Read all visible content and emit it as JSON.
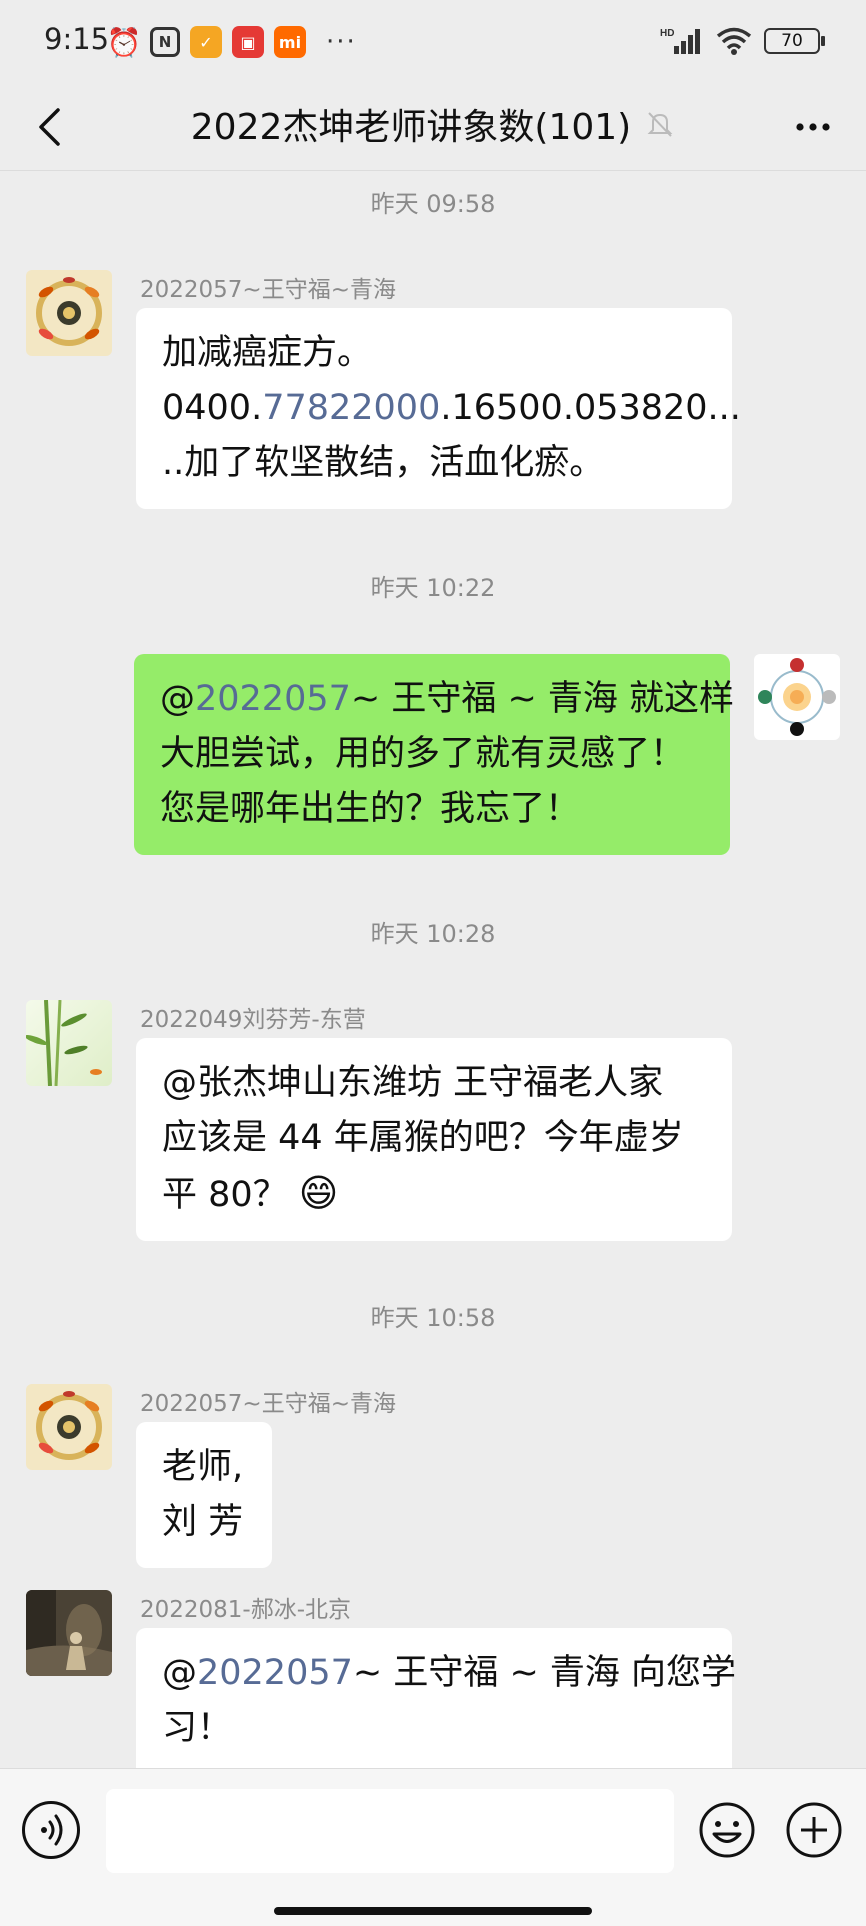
{
  "status_bar": {
    "time": "9:15",
    "network": "HD",
    "battery": "70",
    "more": "···"
  },
  "header": {
    "title": "2022杰坤老师讲象数(101)"
  },
  "messages": [
    {
      "type": "time",
      "text": "昨天 09:58"
    },
    {
      "type": "in",
      "sender": "2022057~王守福~青海",
      "lines": [
        "加减癌症方。",
        "0400.",
        "77822000",
        ".16500.053820...",
        "..加了软坚散结，活血化瘀。"
      ]
    },
    {
      "type": "time",
      "text": "昨天 10:22"
    },
    {
      "type": "out",
      "mention": "@",
      "mention_id": "2022057",
      "text_line1": "~ 王守福 ~ 青海  就这样",
      "text_line2": "大胆尝试，用的多了就有灵感了！",
      "text_line3": "您是哪年出生的？我忘了！"
    },
    {
      "type": "time",
      "text": "昨天 10:28"
    },
    {
      "type": "in",
      "sender": "2022049刘芬芳-东营",
      "lines": [
        "@张杰坤山东潍坊  王守福老人家",
        "应该是 44 年属猴的吧？今年虚岁",
        "平 80？ "
      ],
      "emoji": "😄"
    },
    {
      "type": "time",
      "text": "昨天 10:58"
    },
    {
      "type": "in",
      "sender": "2022057~王守福~青海",
      "lines": [
        "老师,",
        "刘 芳"
      ]
    },
    {
      "type": "in",
      "sender": "2022081-郝冰-北京",
      "mention": "@",
      "mention_id": "2022057",
      "lines": [
        "~ 王守福 ~ 青海  向您学",
        "习！"
      ]
    }
  ],
  "colors": {
    "background": "#ededed",
    "bubble_in": "#ffffff",
    "bubble_out": "#95ec69",
    "mention": "#576b95"
  },
  "icons": [
    "back-arrow-icon",
    "mute-bell-icon",
    "more-icon",
    "voice-icon",
    "emoji-icon",
    "plus-icon"
  ]
}
